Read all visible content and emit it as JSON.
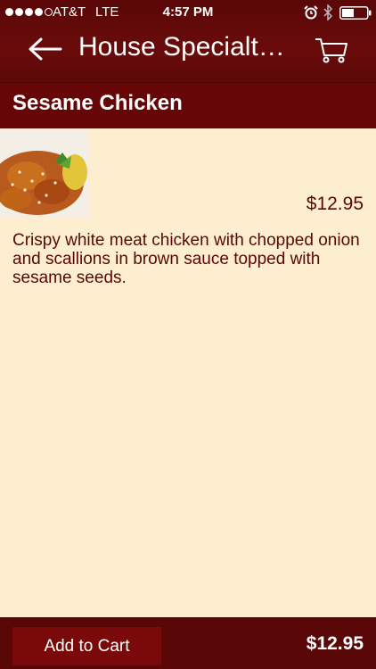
{
  "status_bar": {
    "carrier": "AT&T",
    "network": "LTE",
    "time": "4:57 PM",
    "signal_bars": 4,
    "signal_max": 5
  },
  "nav": {
    "title": "House Specialt…",
    "back_icon": "back-arrow-icon",
    "cart_icon": "cart-icon"
  },
  "item": {
    "name": "Sesame Chicken",
    "price": "$12.95",
    "description": "Crispy white meat chicken with chopped onion and scallions in brown sauce topped with sesame seeds."
  },
  "footer": {
    "add_to_cart_label": "Add to Cart",
    "total": "$12.95"
  },
  "colors": {
    "bar": "#5a0707",
    "header": "#660606",
    "background": "#fdeed0",
    "text": "#5a0707"
  }
}
